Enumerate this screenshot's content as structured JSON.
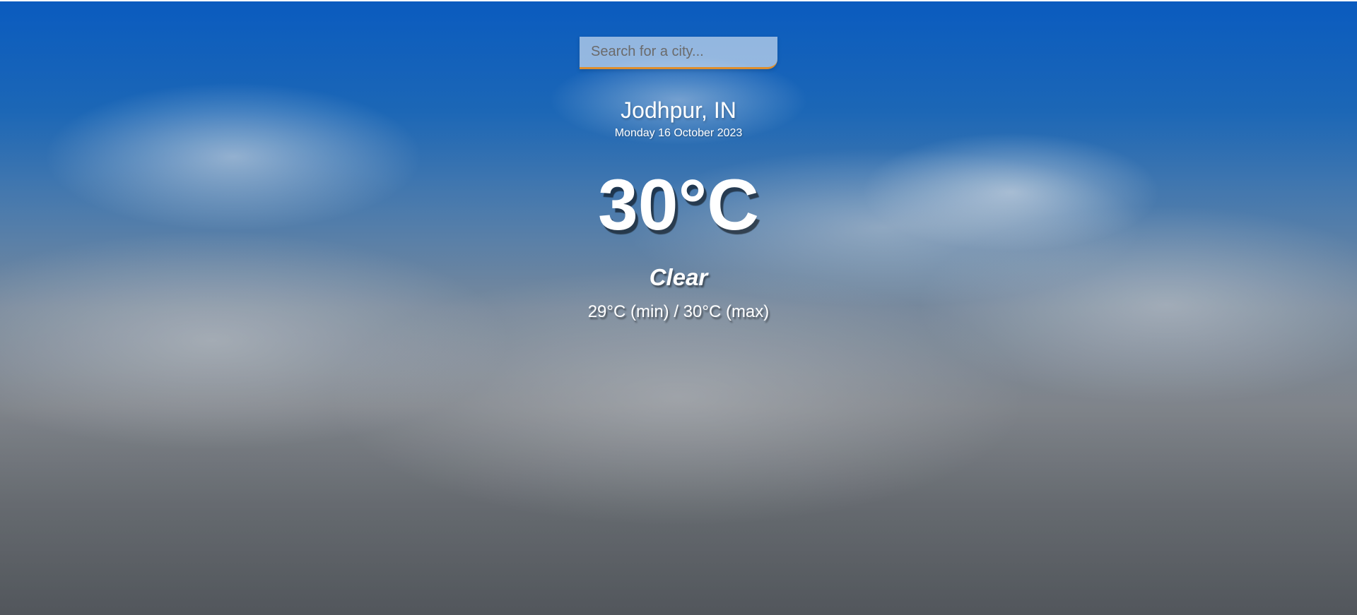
{
  "search": {
    "placeholder": "Search for a city...",
    "value": "",
    "accent_color": "#df8e2c"
  },
  "location": {
    "city": "Jodhpur, IN",
    "date": "Monday 16 October 2023"
  },
  "current": {
    "temp": "30°C",
    "condition": "Clear",
    "hi_low": "29°C (min) / 30°C (max)"
  },
  "background": {
    "description_icon": "sky-clouds-background"
  }
}
